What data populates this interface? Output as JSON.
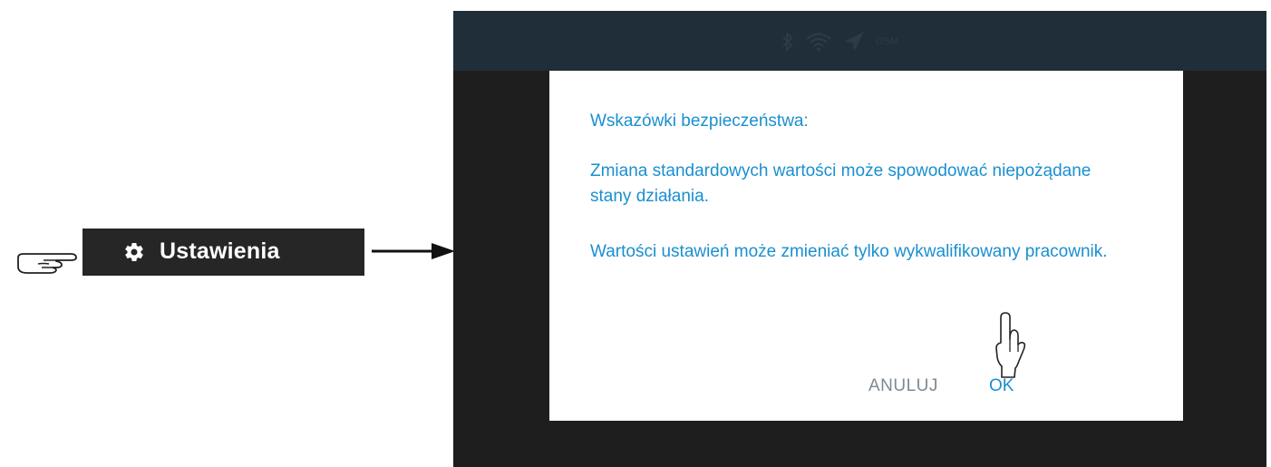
{
  "instruction": {
    "button_label": "Ustawienia",
    "button_icon": "gear-icon",
    "pointer_icon": "pointing-hand-icon",
    "arrow_icon": "arrow-right-icon"
  },
  "status_bar": {
    "icons": [
      "bluetooth-icon",
      "wifi-icon",
      "location-arrow-icon"
    ],
    "gsm_label": "GSM"
  },
  "dialog": {
    "title": "Wskazówki bezpieczeństwa:",
    "paragraph_1": "Zmiana standardowych wartości może spowodować niepożądane stany działania.",
    "paragraph_2": "Wartości ustawień może zmieniać tylko wykwalifikowany pracownik.",
    "cancel_label": "ANULUJ",
    "ok_label": "OK",
    "text_color": "#1a8fd0",
    "cancel_color": "#7e8a93"
  },
  "colors": {
    "device_frame": "#1e1e1e",
    "status_bar": "#1f2e39",
    "instruction_button": "#262626"
  }
}
